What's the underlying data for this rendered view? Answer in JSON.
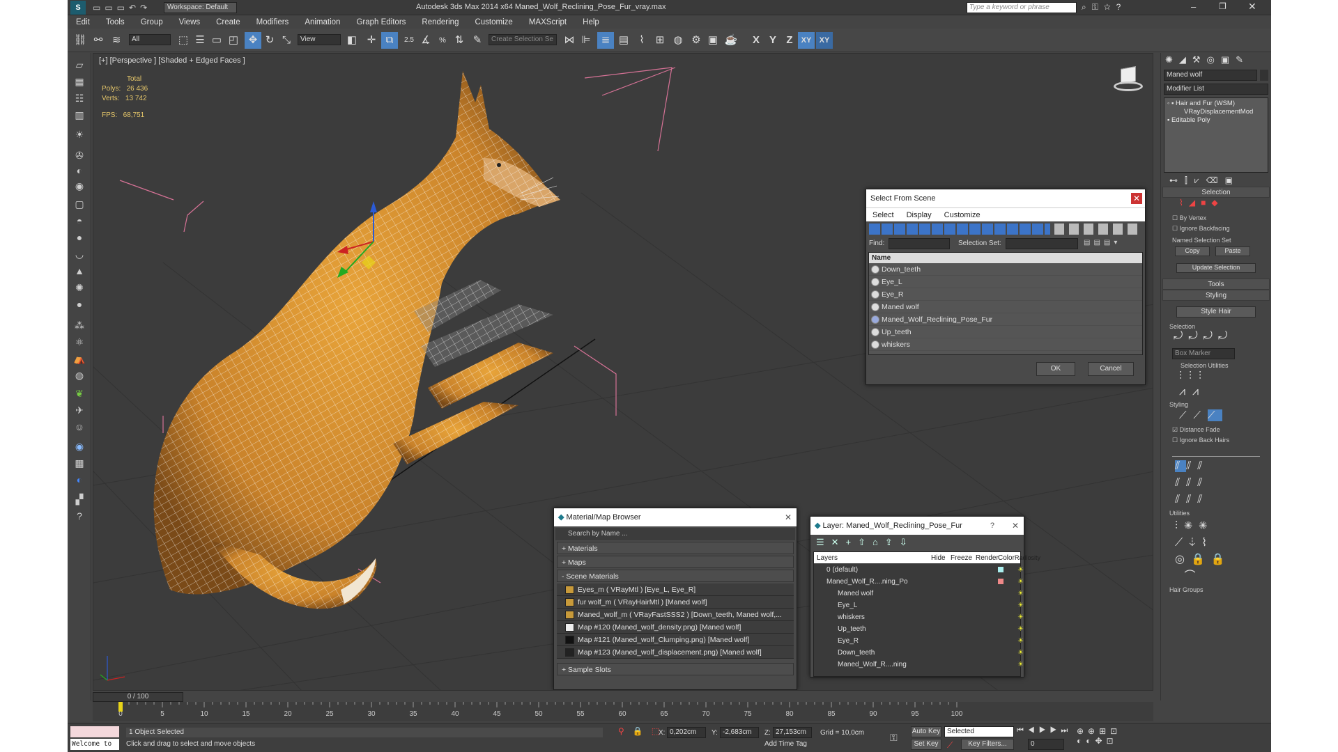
{
  "title_bar": {
    "workspace": "Workspace: Default",
    "title": "Autodesk 3ds Max  2014 x64    Maned_Wolf_Reclining_Pose_Fur_vray.max",
    "search_placeholder": "Type a keyword or phrase"
  },
  "menu": [
    "Edit",
    "Tools",
    "Group",
    "Views",
    "Create",
    "Modifiers",
    "Animation",
    "Graph Editors",
    "Rendering",
    "Customize",
    "MAXScript",
    "Help"
  ],
  "toolbar": {
    "filter": "All",
    "ref_coord": "View",
    "selection_set": "Create Selection Se",
    "axis_labels": [
      "X",
      "Y",
      "Z",
      "XY",
      "XY"
    ],
    "snap_labels": [
      "2.5",
      "%"
    ]
  },
  "viewport": {
    "label": "[+] [Perspective ] [Shaded + Edged Faces ]",
    "stats": {
      "total": "Total",
      "polys_label": "Polys:",
      "polys": "26 436",
      "verts_label": "Verts:",
      "verts": "13 742",
      "fps_label": "FPS:",
      "fps": "68,751"
    }
  },
  "command_panel": {
    "object_name": "Maned wolf",
    "modifier_list": "Modifier List",
    "stack": [
      "Hair and Fur (WSM)",
      "VRayDisplacementMod",
      "Editable Poly"
    ],
    "selection_title": "Selection",
    "by_vertex": "By Vertex",
    "ignore_backfacing": "Ignore Backfacing",
    "named_sel": "Named Selection Set",
    "copy": "Copy",
    "paste": "Paste",
    "update": "Update Selection",
    "tools": "Tools",
    "styling": "Styling",
    "style_hair": "Style Hair",
    "sel_sub": "Selection",
    "box_marker": "Box Marker",
    "sel_utils": "Selection Utilities",
    "styling_sub": "Styling",
    "distance_fade": "Distance Fade",
    "ignore_back_hairs": "Ignore Back Hairs",
    "utilities": "Utilities",
    "hair_groups": "Hair Groups"
  },
  "select_dialog": {
    "title": "Select From Scene",
    "menu": [
      "Select",
      "Display",
      "Customize"
    ],
    "find": "Find:",
    "selection_set": "Selection Set:",
    "column": "Name",
    "items": [
      "Down_teeth",
      "Eye_L",
      "Eye_R",
      "Maned wolf",
      "Maned_Wolf_Reclining_Pose_Fur",
      "Up_teeth",
      "whiskers"
    ],
    "ok": "OK",
    "cancel": "Cancel"
  },
  "material_browser": {
    "title": "Material/Map Browser",
    "search": "Search by Name ...",
    "sections": [
      "+ Materials",
      "+ Maps",
      "- Scene Materials"
    ],
    "items": [
      "Eyes_m  ( VRayMtl )  [Eye_L, Eye_R]",
      "fur wolf_m  ( VRayHairMtl )  [Maned wolf]",
      "Maned_wolf_m  ( VRayFastSSS2 )  [Down_teeth, Maned wolf,...",
      "Map #120 (Maned_wolf_density.png)  [Maned wolf]",
      "Map #121 (Maned_wolf_Clumping.png)  [Maned wolf]",
      "Map #123 (Maned_wolf_displacement.png)  [Maned wolf]"
    ],
    "sample_slots": "+ Sample Slots"
  },
  "layer_dialog": {
    "title": "Layer: Maned_Wolf_Reclining_Pose_Fur",
    "help": "?",
    "columns": [
      "Layers",
      "Hide",
      "Freeze",
      "Render",
      "Color",
      "Radiosity"
    ],
    "rows": [
      "0 (default)",
      "Maned_Wolf_R....ning_Po",
      "Maned wolf",
      "Eye_L",
      "whiskers",
      "Up_teeth",
      "Eye_R",
      "Down_teeth",
      "Maned_Wolf_R....ning"
    ]
  },
  "timeline": {
    "frame": "0 / 100",
    "ticks": [
      "0",
      "5",
      "10",
      "15",
      "20",
      "25",
      "30",
      "35",
      "40",
      "45",
      "50",
      "55",
      "60",
      "65",
      "70",
      "75",
      "80",
      "85",
      "90",
      "95",
      "100"
    ]
  },
  "status": {
    "listener": "Welcome to M",
    "selected": "1 Object Selected",
    "hint": "Click and drag to select and move objects",
    "x_label": "X:",
    "x": "0,202cm",
    "y_label": "Y:",
    "y": "-2,683cm",
    "z_label": "Z:",
    "z": "27,153cm",
    "grid": "Grid = 10,0cm",
    "add_time_tag": "Add Time Tag",
    "auto_key": "Auto Key",
    "set_key": "Set Key",
    "selected_dd": "Selected",
    "key_filters": "Key Filters...",
    "frame_field": "0"
  }
}
